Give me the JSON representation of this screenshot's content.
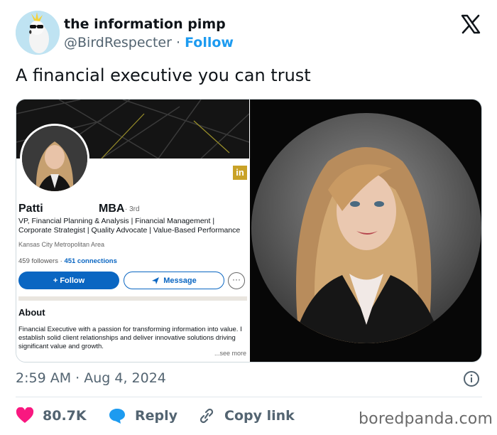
{
  "author": {
    "display_name": "the information pimp",
    "handle": "@BirdRespecter",
    "separator": "·",
    "follow_label": "Follow",
    "avatar_icon": "cockatoo-avatar-icon"
  },
  "tweet": {
    "text": "A financial executive you can trust",
    "timestamp": "2:59 AM · Aug 4, 2024"
  },
  "linkedin": {
    "badge": "in",
    "first_name": "Patti",
    "suffix": "MBA",
    "degree": "· 3rd",
    "headline": "VP, Financial Planning & Analysis | Financial Management | Corporate Strategist | Quality Advocate | Value-Based Performance",
    "location": "Kansas City Metropolitan Area",
    "followers": "459 followers",
    "stats_sep": " · ",
    "connections": "451 connections",
    "follow_label": "+ Follow",
    "message_label": "Message",
    "more_label": "···",
    "about_title": "About",
    "about_text": "Financial Executive with a passion for transforming information into value. I establish solid client relationships and deliver innovative solutions driving significant value and growth.",
    "see_more": "...see more",
    "brand_color": "#0a66c2"
  },
  "actions": {
    "likes": "80.7K",
    "reply_label": "Reply",
    "copy_link_label": "Copy link",
    "like_color": "#f91880",
    "reply_color": "#1d9bf0"
  },
  "watermark": "boredpanda.com"
}
